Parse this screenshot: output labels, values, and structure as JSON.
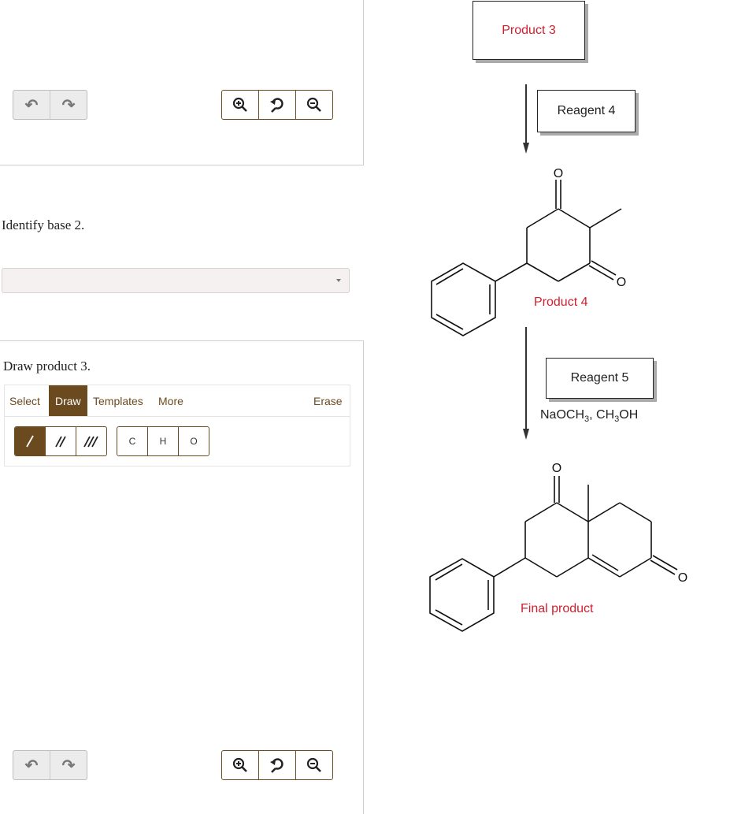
{
  "left": {
    "question_base": "Identify base 2.",
    "question_product": "Draw product 3.",
    "dropdown": {
      "selected": ""
    },
    "tabs": {
      "select": "Select",
      "draw": "Draw",
      "templates": "Templates",
      "more": "More",
      "erase": "Erase"
    },
    "atoms": [
      "C",
      "H",
      "O"
    ]
  },
  "scheme": {
    "product3": "Product 3",
    "reagent4": "Reagent 4",
    "product4": "Product 4",
    "reagent5": "Reagent 5",
    "conditions": {
      "part1": "NaOCH",
      "sub1": "3",
      "part2": ", CH",
      "sub2": "3",
      "part3": "OH"
    },
    "final": "Final product",
    "oxygen": "O"
  },
  "colors": {
    "accent": "#6b4a1f",
    "label_red": "#d0202e"
  },
  "icons": [
    "undo-icon",
    "redo-icon",
    "zoom-in-icon",
    "zoom-reset-icon",
    "zoom-out-icon"
  ]
}
